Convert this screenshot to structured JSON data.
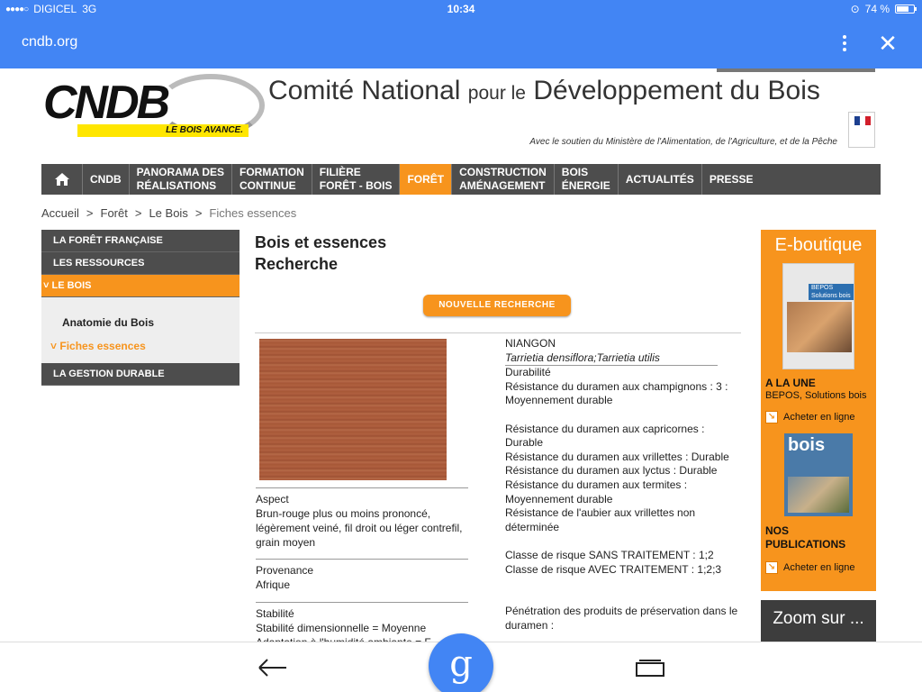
{
  "status": {
    "carrier": "DIGICEL",
    "network": "3G",
    "time": "10:34",
    "battery_text": "74 %",
    "battery_level": 0.74
  },
  "browser": {
    "url": "cndb.org"
  },
  "header": {
    "logo_text": "CNDB",
    "logo_tagline": "LE BOIS AVANCE.",
    "title_part1": "Comité National",
    "title_part2": "pour le",
    "title_part3": "Développement du Bois",
    "support_text": "Avec le soutien du Ministère de l'Alimentation, de l'Agriculture, et de la Pêche"
  },
  "nav": [
    "CNDB",
    "PANORAMA DES\nRÉALISATIONS",
    "FORMATION\nCONTINUE",
    "FILIÈRE\nFORÊT - BOIS",
    "FORÊT",
    "CONSTRUCTION\nAMÉNAGEMENT",
    "BOIS\nÉNERGIE",
    "ACTUALITÉS",
    "PRESSE"
  ],
  "breadcrumb": [
    "Accueil",
    "Forêt",
    "Le Bois",
    "Fiches essences"
  ],
  "breadcrumb_sep": ">",
  "sidebar": {
    "items": [
      "LA FORÊT FRANÇAISE",
      "LES RESSOURCES",
      "LE BOIS",
      "LA GESTION DURABLE"
    ],
    "sub": [
      "Anatomie du Bois",
      "Fiches essences"
    ],
    "bullet": "˅"
  },
  "main": {
    "title_line1": "Bois et essences",
    "title_line2": "Recherche",
    "new_search": "NOUVELLE RECHERCHE",
    "aspect_label": "Aspect",
    "aspect_text": "Brun-rouge plus ou moins prononcé, légèrement veiné, fil droit ou léger contrefil, grain moyen",
    "provenance_label": "Provenance",
    "provenance_text": "Afrique",
    "stabilite_label": "Stabilité",
    "stabilite_line1": "Stabilité dimensionnelle =  Moyenne",
    "stabilite_line2": "Adaptation à l'humidité ambiante =  F",
    "species_name": "NIANGON",
    "species_latin": "Tarrietia densiflora;Tarrietia utilis",
    "durabilite_label": "Durabilité",
    "durabilite": [
      "Résistance du duramen aux champignons : 3 : Moyennement durable",
      "",
      "Résistance du duramen aux capricornes : Durable",
      "Résistance du duramen aux vrillettes : Durable",
      "Résistance du duramen aux lyctus :  Durable",
      "Résistance du duramen aux termites : Moyennement durable",
      "Résistance de l'aubier aux vrillettes non déterminée",
      "",
      "Classe de risque SANS TRAITEMENT :  1;2",
      "Classe de risque AVEC TRAITEMENT :  1;2;3",
      "",
      "",
      "Pénétration des produits de préservation dans le duramen :"
    ]
  },
  "boutique": {
    "heading": "E-boutique",
    "book1_band": "BEPOS Solutions bois",
    "a_la_une": "A LA UNE",
    "a_la_une_sub": "BEPOS, Solutions bois",
    "link1": "Acheter en ligne",
    "book2_title": "bois",
    "nos_pub": "NOS PUBLICATIONS",
    "link2": "Acheter en ligne",
    "arrow": "↘",
    "zoom": "Zoom sur ..."
  },
  "bottom": {
    "google_letter": "g"
  }
}
